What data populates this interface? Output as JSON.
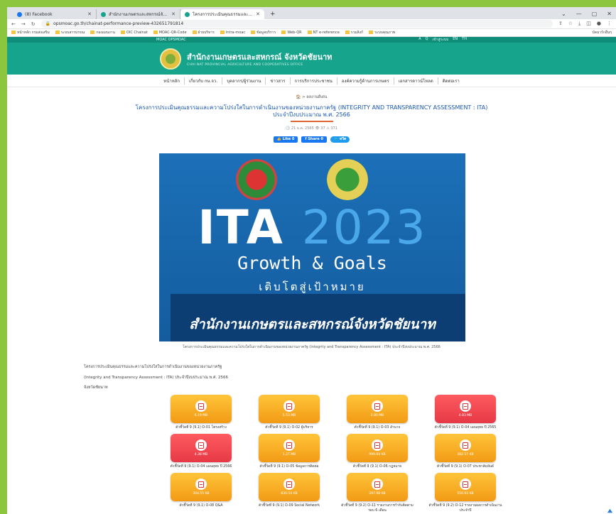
{
  "browser": {
    "tabs": [
      {
        "label": "(8) Facebook",
        "color": "#1877f2",
        "active": false
      },
      {
        "label": "สำนักงานเกษตรและสหกรณ์จังหวัดชัยนาท",
        "color": "#16a58c",
        "active": false
      },
      {
        "label": "โครงการประเมินคุณธรรมและความโปร่งใส",
        "color": "#16a58c",
        "active": true
      }
    ],
    "new_tab": "+",
    "window_controls": [
      "⌄",
      "—",
      "▢",
      "✕"
    ],
    "url": "opsmoac.go.th/chainat-performance-preview-432651791814",
    "bookmarks": [
      "หน้าหลัก กรมส่งเสริม",
      "ระบบสารบรรณ",
      "กองแผนงาน",
      "OIC Chainat",
      "MOAC-QR-Code",
      "ฝ่ายบริหาร",
      "Intra-moac",
      "ข้อมูลบริการ",
      "Web-QR",
      "NT e-reference",
      "รวมลิงก์",
      "ระบบคุณภาพ"
    ],
    "bookmarks_right": "บัคมาร์กอื่นๆ"
  },
  "site": {
    "topstrip_left": "MOAC   OPSMOAC",
    "topstrip_right": [
      "A",
      "Q",
      "เข้าสู่ระบบ",
      "EN",
      "TH"
    ],
    "org_th": "สำนักงานเกษตรและสหกรณ์ จังหวัดชัยนาท",
    "org_en": "CHAI NAT PROVINCIAL AGRICULTURE AND COOPERATIVES OFFICE",
    "nav": [
      "หน้าหลัก",
      "เกี่ยวกับ กษ.จว.",
      "บุคลากร/ผู้ร่วมงาน",
      "ข่าวสาร",
      "การบริการประชาชน",
      "องค์ความรู้ด้านการเกษตร",
      "เอกสารดาวน์โหลด",
      "ติดต่อเรา"
    ]
  },
  "article": {
    "breadcrumb": "🏠  >  ผลงานดีเด่น",
    "title_line1": "โครงการประเมินคุณธรรมและความโปร่งใสในการดำเนินงานของหน่วยงานภาครัฐ (INTEGRITY AND TRANSPARENCY ASSESSMENT : ITA)",
    "title_line2": "ประจำปีงบประมาณ พ.ศ. 2566",
    "meta": "🕒 21 ธ.ค. 2565   👁 37   ⚠ 371",
    "share": {
      "like": "👍 Like 0",
      "fb_share": "f Share 0",
      "tweet": "🐦 ทวีต"
    },
    "banner": {
      "ita": "ITA",
      "year": "2023",
      "growth": "Growth & Goals",
      "tag_th": "เติบโตสู่เป้าหมาย",
      "org_th": "สำนักงานเกษตรและสหกรณ์จังหวัดชัยนาท"
    },
    "caption": "โครงการประเมินคุณธรรมและความโปร่งใสในการดำเนินงานของหน่วยงานภาครัฐ (Integrity and Transparency Assessment : ITA) ประจำปีงบประมาณ พ.ศ. 2566",
    "body": [
      "โครงการประเมินคุณธรรมและความโปร่งใสในการดำเนินงานของหน่วยงานภาครัฐ",
      "(Integrity and Transparency Assessment : ITA) ประจำปีงบประมาณ พ.ศ. 2566",
      "จังหวัดชัยนาท"
    ],
    "documents": [
      {
        "size": "6.19 MB",
        "label": "ตัวชี้วัดที่ 9 (9.1) O-01 โครงสร้าง",
        "variant": "orange"
      },
      {
        "size": "5.53 MB",
        "label": "ตัวชี้วัดที่ 9 (9.1) O-02 ผู้บริหาร",
        "variant": "orange"
      },
      {
        "size": "2.80 MB",
        "label": "ตัวชี้วัดที่ 9 (9.1) O-03 อำนาจ",
        "variant": "orange"
      },
      {
        "size": "4.83 MB",
        "label": "ตัวชี้วัดที่ 9 (9.1) O-04 แผนยุทธ ปี 2565",
        "variant": "red"
      },
      {
        "size": "4.38 MB",
        "label": "ตัวชี้วัดที่ 9 (9.1) O-04 แผนยุทธ ปี 2566",
        "variant": "red"
      },
      {
        "size": "1.27 MB",
        "label": "ตัวชี้วัดที่ 9 (9.1) O-05 ข้อมูลการติดต่อ",
        "variant": "orange"
      },
      {
        "size": "999.84 KB",
        "label": "ตัวชี้วัดที่ 9 (9.1) O-06 กฎหมาย",
        "variant": "orange"
      },
      {
        "size": "382.57 KB",
        "label": "ตัวชี้วัดที่ 9 (9.1) O-07 ประชาสัมพันธ์",
        "variant": "orange"
      },
      {
        "size": "304.55 KB",
        "label": "ตัวชี้วัดที่ 9 (9.1) O-08 Q&A",
        "variant": "orange"
      },
      {
        "size": "830.54 KB",
        "label": "ตัวชี้วัดที่ 9 (9.1) O-09 Social Network",
        "variant": "orange"
      },
      {
        "size": "297.98 KB",
        "label": "ตัวชี้วัดที่ 9 (9.2) O-11 รายงานการกำกับติดตาม รอบ 6 เดือน",
        "variant": "orange"
      },
      {
        "size": "550.93 KB",
        "label": "ตัวชี้วัดที่ 9 (9.2) O-12 รายงานผลการดำเนินงาน ประจำปี",
        "variant": "orange"
      }
    ]
  }
}
